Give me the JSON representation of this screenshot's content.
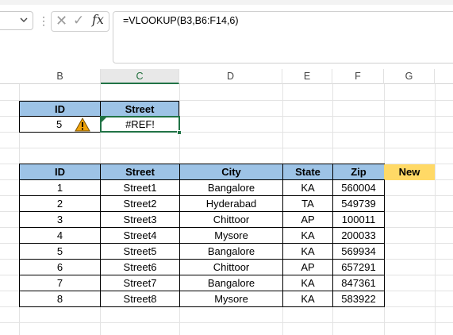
{
  "formula_bar": {
    "cancel_icon": "✕",
    "enter_icon": "✓",
    "fx_label": "fx",
    "formula": "=VLOOKUP(B3,B6:F14,6)"
  },
  "columns": [
    "B",
    "C",
    "D",
    "E",
    "F",
    "G"
  ],
  "active_column": "C",
  "lookup": {
    "headers": [
      "ID",
      "Street"
    ],
    "id_value": "5",
    "result": "#REF!",
    "warning_icon": "warning-triangle"
  },
  "table": {
    "headers": [
      "ID",
      "Street",
      "City",
      "State",
      "Zip"
    ],
    "extra_header": "New",
    "rows": [
      [
        "1",
        "Street1",
        "Bangalore",
        "KA",
        "560004"
      ],
      [
        "2",
        "Street2",
        "Hyderabad",
        "TA",
        "549739"
      ],
      [
        "3",
        "Street3",
        "Chittoor",
        "AP",
        "100011"
      ],
      [
        "4",
        "Street4",
        "Mysore",
        "KA",
        "200033"
      ],
      [
        "5",
        "Street5",
        "Bangalore",
        "KA",
        "569934"
      ],
      [
        "6",
        "Street6",
        "Chittoor",
        "AP",
        "657291"
      ],
      [
        "7",
        "Street7",
        "Bangalore",
        "KA",
        "847361"
      ],
      [
        "8",
        "Street8",
        "Mysore",
        "KA",
        "583922"
      ]
    ]
  },
  "colors": {
    "header_fill": "#9dc3e6",
    "new_fill": "#ffd966",
    "selection": "#217346",
    "warning": "#f0a30a"
  }
}
